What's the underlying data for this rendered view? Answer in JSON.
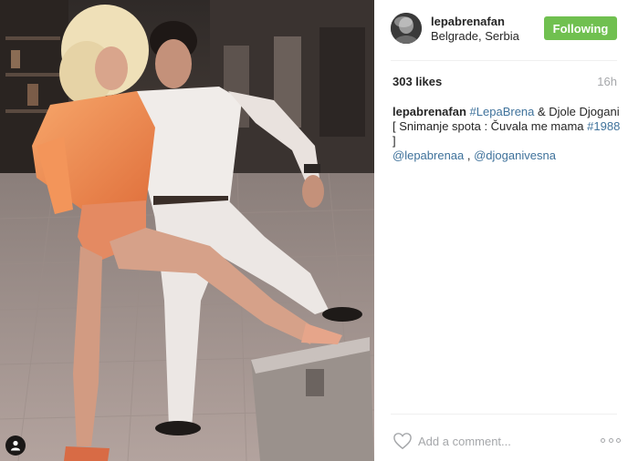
{
  "post": {
    "image_alt": "Vintage photo: a woman in an orange jacket and a man in white posing on a street",
    "tag_icon": "person-icon"
  },
  "header": {
    "username": "lepabrenafan",
    "location": "Belgrade, Serbia",
    "follow_label": "Following"
  },
  "stats": {
    "likes": "303 likes",
    "time": "16h"
  },
  "caption": {
    "user": "lepabrenafan",
    "hashtag_1": "#LepaBrena",
    "text_1": " & Djole Djogani [ Snimanje spota : Čuvala me mama ",
    "hashtag_2": "#1988",
    "text_2": " ] ",
    "mention_1": "@lepabrenaa",
    "text_3": " , ",
    "mention_2": "@djoganivesna"
  },
  "comment": {
    "placeholder": "Add a comment..."
  },
  "colors": {
    "follow_bg": "#70c050",
    "link": "#3f729b",
    "muted": "#a5a7aa"
  }
}
